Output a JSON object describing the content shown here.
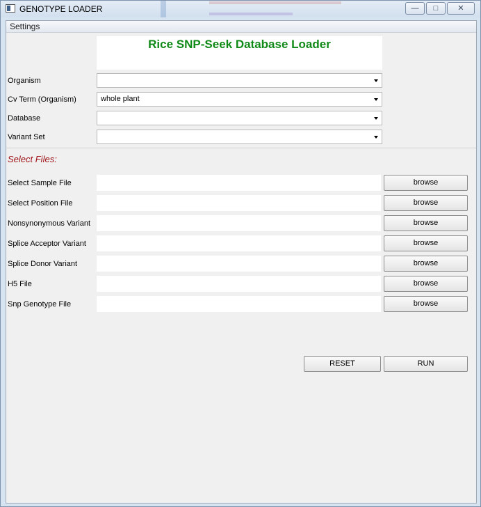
{
  "window": {
    "title": "GENOTYPE LOADER",
    "controls": [
      "minimize",
      "maximize",
      "close"
    ]
  },
  "menu": {
    "items": [
      "Settings"
    ]
  },
  "header": {
    "title": "Rice SNP-Seek Database Loader",
    "title_color": "#0f8a16"
  },
  "fields": {
    "organism": {
      "label": "Organism",
      "value": ""
    },
    "cv_term": {
      "label": "Cv Term (Organism)",
      "value": "whole plant"
    },
    "database": {
      "label": "Database",
      "value": ""
    },
    "variant_set": {
      "label": "Variant Set",
      "value": ""
    }
  },
  "files": {
    "section_title": "Select Files:",
    "section_color": "#a0141a",
    "browse_label": "browse",
    "rows": [
      {
        "label": "Select Sample File",
        "value": ""
      },
      {
        "label": "Select Position File",
        "value": ""
      },
      {
        "label": "Nonsynonymous Variant",
        "value": ""
      },
      {
        "label": "Splice Acceptor Variant",
        "value": ""
      },
      {
        "label": "Splice Donor Variant",
        "value": ""
      },
      {
        "label": "H5 File",
        "value": ""
      },
      {
        "label": "Snp Genotype File",
        "value": ""
      }
    ]
  },
  "actions": {
    "reset": "RESET",
    "run": "RUN"
  }
}
